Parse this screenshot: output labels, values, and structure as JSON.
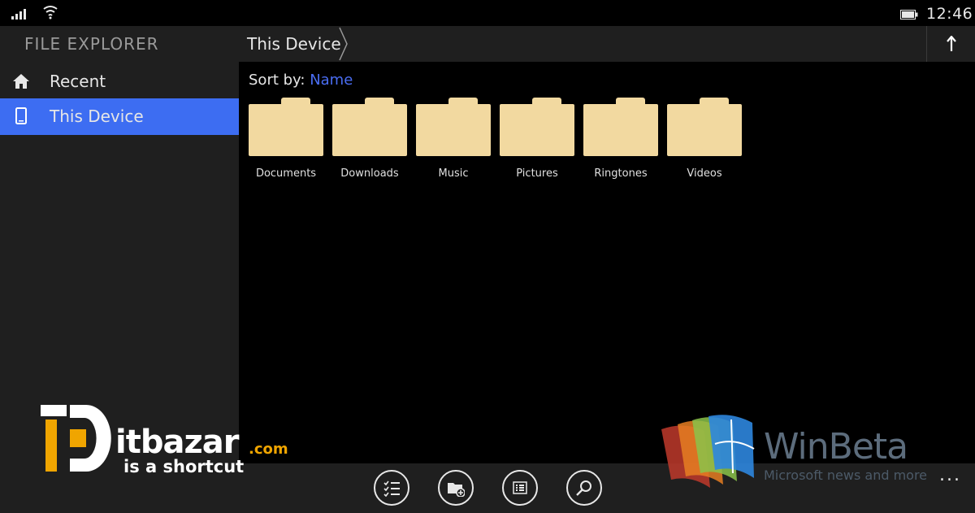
{
  "status_bar": {
    "time": "12:46",
    "icons": [
      "signal-icon",
      "wifi-icon",
      "battery-icon"
    ]
  },
  "sidebar": {
    "title": "FILE EXPLORER",
    "items": [
      {
        "label": "Recent",
        "icon": "home-icon",
        "selected": false
      },
      {
        "label": "This Device",
        "icon": "phone-icon",
        "selected": true
      }
    ]
  },
  "header": {
    "breadcrumb": "This Device",
    "up_icon": "arrow-up-icon"
  },
  "content": {
    "sort_label": "Sort by:",
    "sort_value": "Name",
    "folders": [
      {
        "label": "Documents"
      },
      {
        "label": "Downloads"
      },
      {
        "label": "Music"
      },
      {
        "label": "Pictures"
      },
      {
        "label": "Ringtones"
      },
      {
        "label": "Videos"
      }
    ]
  },
  "appbar": {
    "buttons": [
      "select-icon",
      "new-folder-icon",
      "list-view-icon",
      "search-icon"
    ],
    "more": "..."
  },
  "watermarks": {
    "itbazar": {
      "name": "itbazar",
      "domain": ".com",
      "tagline": "is a shortcut"
    },
    "winbeta": {
      "name": "WinBeta",
      "tagline": "Microsoft news and more"
    }
  },
  "colors": {
    "accent": "#3d6df2",
    "sort_value": "#4a6df2",
    "folder": "#f2d9a0",
    "panel": "#1f1f1f",
    "background": "#000000"
  }
}
